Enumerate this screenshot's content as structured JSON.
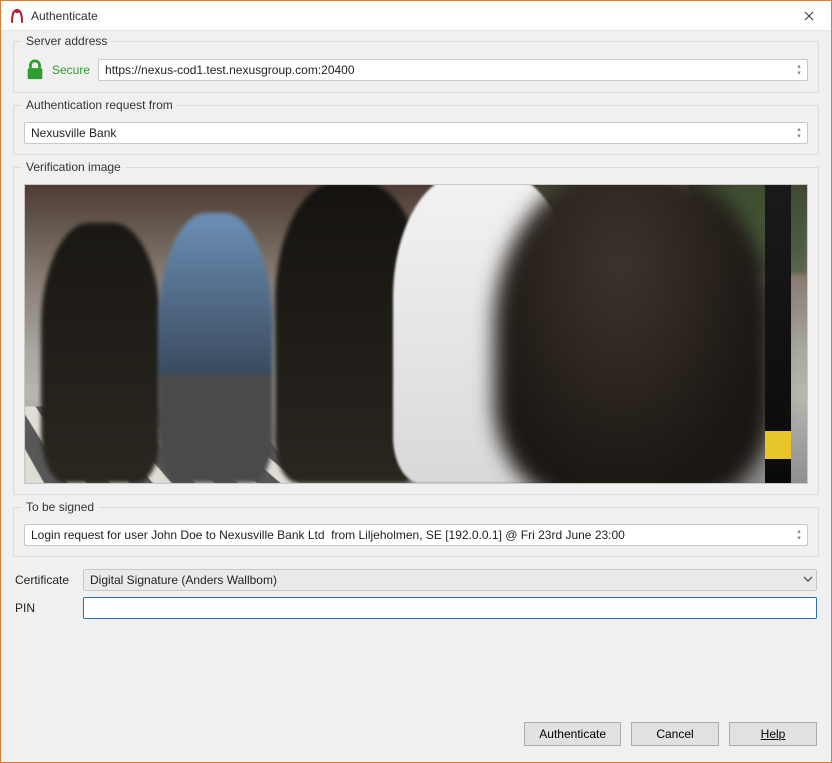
{
  "window": {
    "title": "Authenticate"
  },
  "server": {
    "legend": "Server address",
    "secure_label": "Secure",
    "url": "https://nexus-cod1.test.nexusgroup.com:20400"
  },
  "auth_from": {
    "legend": "Authentication request from",
    "value": "Nexusville Bank"
  },
  "verification": {
    "legend": "Verification image",
    "image_desc": "photo-crowd-street"
  },
  "to_be_signed": {
    "legend": "To be signed",
    "value": "Login request for user John Doe to Nexusville Bank Ltd  from Liljeholmen, SE [192.0.0.1] @ Fri 23rd June 23:00"
  },
  "certificate": {
    "label": "Certificate",
    "value": "Digital Signature (Anders Wallbom)"
  },
  "pin": {
    "label": "PIN",
    "value": ""
  },
  "buttons": {
    "authenticate": "Authenticate",
    "cancel": "Cancel",
    "help": "Help"
  }
}
